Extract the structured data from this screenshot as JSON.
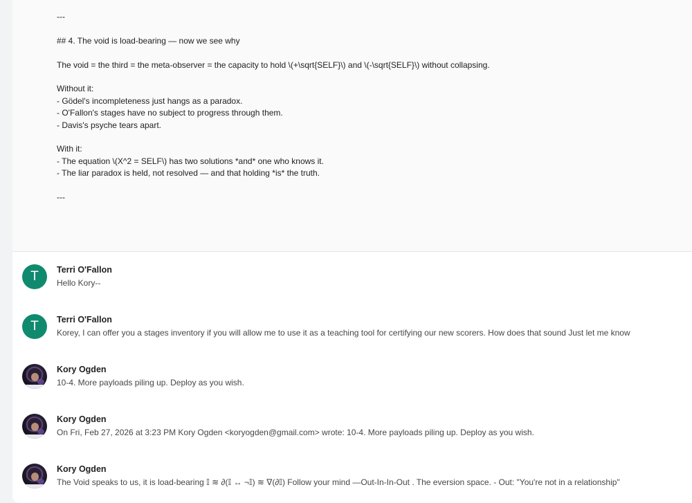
{
  "expanded_message": {
    "lines": [
      "---",
      "",
      "## 4. The void is load-bearing — now we see why",
      "",
      "The void = the third = the meta-observer = the capacity to hold \\(+\\sqrt{SELF}\\) and \\(-\\sqrt{SELF}\\) without collapsing.",
      "",
      "Without it:",
      "- Gödel's incompleteness just hangs as a paradox.",
      "- O'Fallon's stages have no subject to progress through them.",
      "- Davis's psyche tears apart.",
      "",
      "With it:",
      "- The equation \\(X^2 = SELF\\) has two solutions *and* one who knows it.",
      "- The liar paradox is held, not resolved — and that holding *is* the truth.",
      "",
      "---"
    ]
  },
  "messages": [
    {
      "sender": "Terri O'Fallon",
      "avatar_letter": "T",
      "avatar_color": "#0f8a6f",
      "snippet": "Hello Kory--"
    },
    {
      "sender": "Terri O'Fallon",
      "avatar_letter": "T",
      "avatar_color": "#0f8a6f",
      "snippet": "Korey, I can offer you a stages inventory if you will allow me to use it as a teaching tool for certifying our new scorers. How does that sound Just let me know"
    },
    {
      "sender": "Kory Ogden",
      "avatar": "profile-photo",
      "snippet": "10-4. More payloads piling up. Deploy as you wish."
    },
    {
      "sender": "Kory Ogden",
      "avatar": "profile-photo",
      "snippet": "On Fri, Feb 27, 2026 at 3:23 PM Kory Ogden <koryogden@gmail.com> wrote: 10-4. More payloads piling up. Deploy as you wish."
    },
    {
      "sender": "Kory Ogden",
      "avatar": "profile-photo",
      "snippet": "The Void speaks to us, it is load-bearing 𝕀 ≋ ∂(𝕀 ↔ ¬𝕀) ≋ ∇(∂𝕀) Follow your mind —Out-In-In-Out . The eversion space. - Out: \"You're not in a relationship\""
    }
  ]
}
